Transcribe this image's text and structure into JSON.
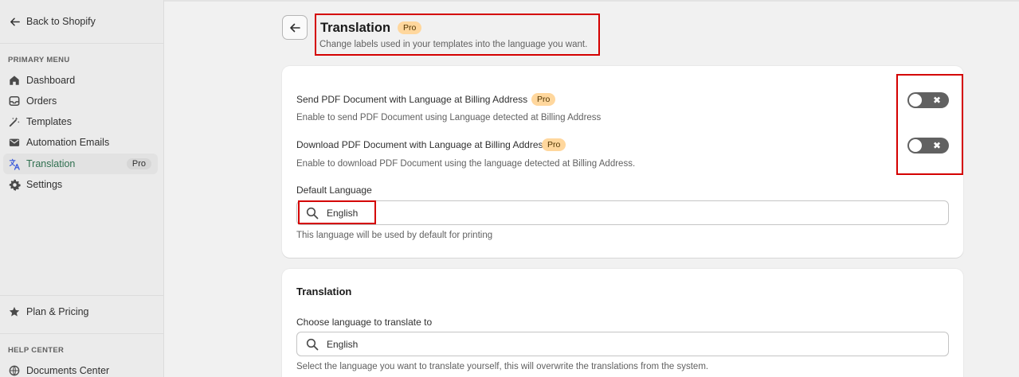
{
  "sidebar": {
    "back_label": "Back to Shopify",
    "primary_menu_heading": "PRIMARY MENU",
    "items": [
      {
        "label": "Dashboard",
        "icon": "home-icon"
      },
      {
        "label": "Orders",
        "icon": "inbox-icon"
      },
      {
        "label": "Templates",
        "icon": "magic-wand-icon"
      },
      {
        "label": "Automation Emails",
        "icon": "envelope-icon"
      },
      {
        "label": "Translation",
        "icon": "translate-icon",
        "badge": "Pro",
        "active": true
      },
      {
        "label": "Settings",
        "icon": "gear-icon"
      }
    ],
    "plan_label": "Plan & Pricing",
    "help_heading": "HELP CENTER",
    "documents_label": "Documents Center"
  },
  "header": {
    "title": "Translation",
    "badge": "Pro",
    "subtitle": "Change labels used in your templates into the language you want."
  },
  "settings_card": {
    "send_pdf": {
      "label": "Send PDF Document with Language at Billing Address",
      "badge": "Pro",
      "description": "Enable to send PDF Document using Language detected at Billing Address",
      "enabled": false
    },
    "download_pdf": {
      "label": "Download PDF Document with Language at Billing Address",
      "badge": "Pro",
      "description": "Enable to download PDF Document using the language detected at Billing Address.",
      "enabled": false
    },
    "default_language": {
      "label": "Default Language",
      "value": "English",
      "help": "This language will be used by default for printing"
    }
  },
  "translation_card": {
    "title": "Translation",
    "choose_label": "Choose language to translate to",
    "value": "English",
    "help": "Select the language you want to translate yourself, this will overwrite the translations from the system."
  },
  "colors": {
    "highlight_border": "#d40000",
    "pro_badge_bg": "#ffd79d",
    "active_nav_text": "#2f6f4f",
    "toggle_off": "#616161"
  }
}
